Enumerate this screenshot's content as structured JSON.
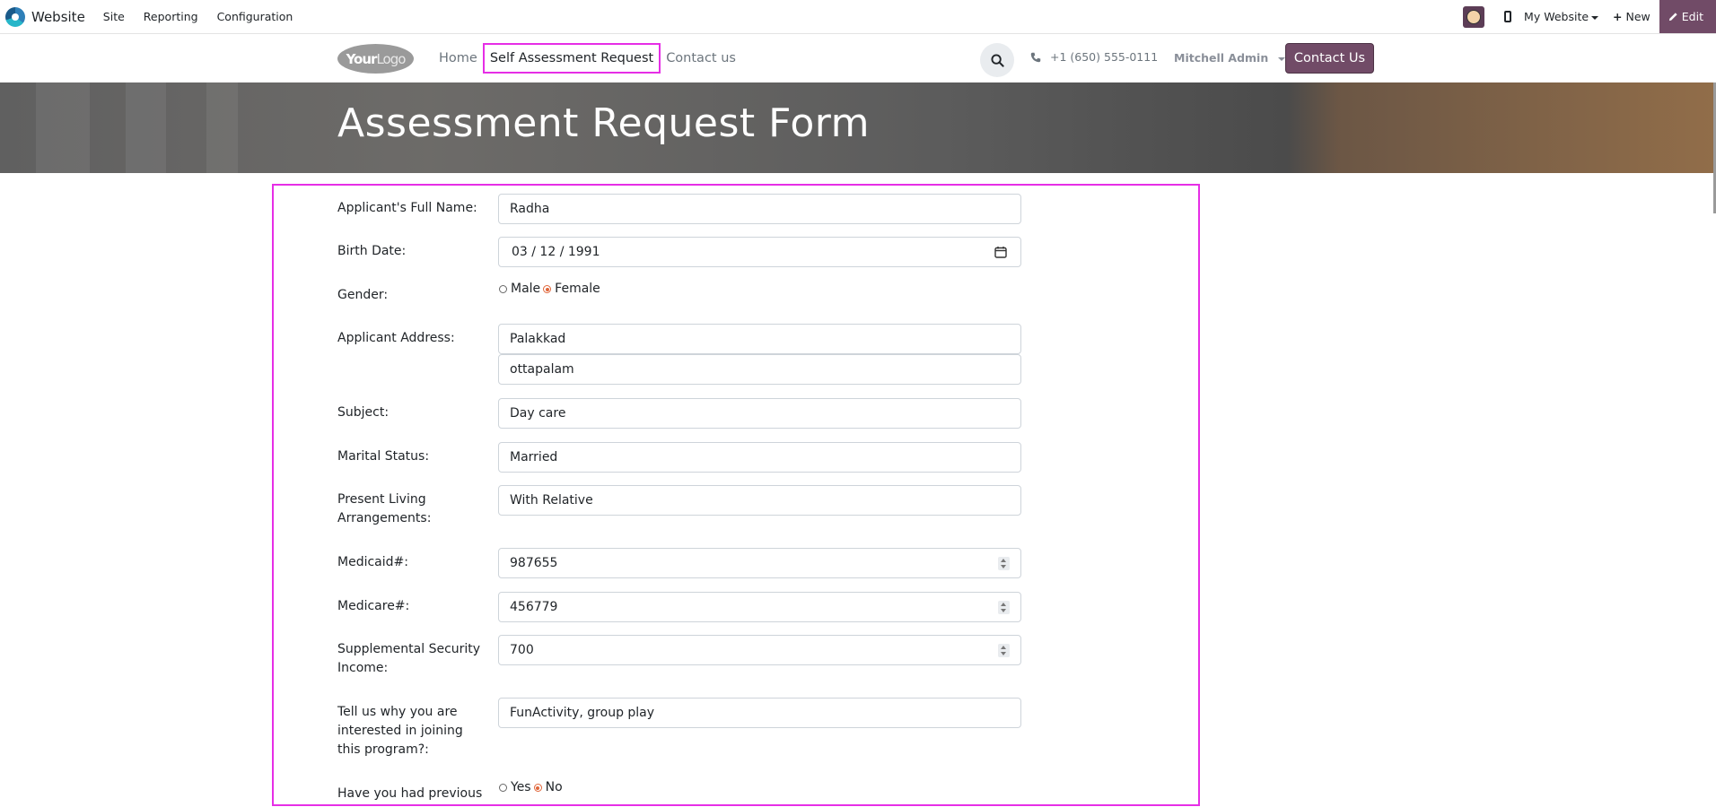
{
  "admin_bar": {
    "app_title": "Website",
    "menu": [
      "Site",
      "Reporting",
      "Configuration"
    ],
    "my_website": "My Website",
    "new_label": "New",
    "edit_label": "Edit"
  },
  "header": {
    "logo_bold": "Your",
    "logo_light": "Logo",
    "nav": [
      "Home",
      "Self Assessment Request",
      "Contact us"
    ],
    "phone": "+1 (650) 555-0111",
    "user": "Mitchell Admin",
    "contact_button": "Contact Us"
  },
  "hero": {
    "title": "Assessment Request Form"
  },
  "form": {
    "full_name_label": "Applicant's Full Name:",
    "full_name_value": "Radha",
    "birth_label": "Birth Date:",
    "birth_value": "03 / 12 / 1991",
    "gender_label": "Gender:",
    "gender_options": [
      "Male",
      "Female"
    ],
    "gender_selected": "Female",
    "address_label": "Applicant Address:",
    "address_line1": "Palakkad",
    "address_line2": "ottapalam",
    "subject_label": "Subject:",
    "subject_value": "Day care",
    "marital_label": "Marital Status:",
    "marital_value": "Married",
    "living_label": "Present Living Arrangements:",
    "living_value": "With Relative",
    "medicaid_label": "Medicaid#:",
    "medicaid_value": "987655",
    "medicare_label": "Medicare#:",
    "medicare_value": "456779",
    "ssi_label": "Supplemental Security Income:",
    "ssi_value": "700",
    "why_label": "Tell us why you are interested in joining this program?:",
    "why_value": "FunActivity, group play",
    "previous_label": "Have you had previous",
    "previous_options": [
      "Yes",
      "No"
    ],
    "previous_selected": "No"
  },
  "colors": {
    "brand": "#714b67",
    "highlight": "#e62ee6",
    "radio_checked": "#e0663a"
  }
}
